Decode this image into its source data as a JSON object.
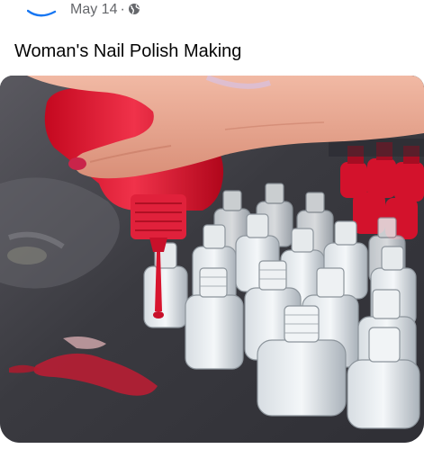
{
  "post": {
    "date": "May 14",
    "separator": "·",
    "privacy_icon": "globe-icon",
    "title": "Woman's Nail Polish Making"
  },
  "media": {
    "type": "video-frame",
    "accent": "#e8102a",
    "skin": "#e7a58f",
    "surface": "#4a4a50"
  }
}
